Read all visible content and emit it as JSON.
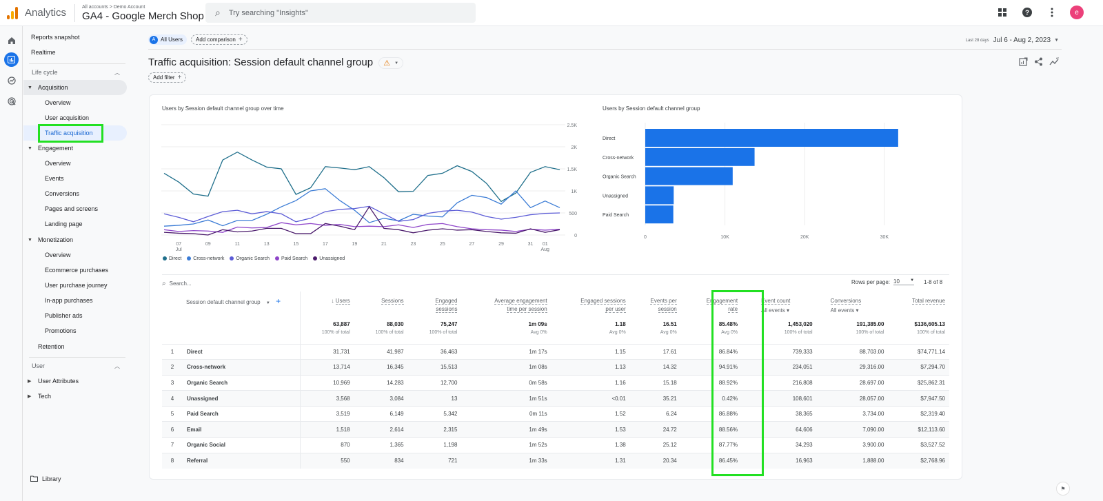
{
  "app": {
    "brand": "Analytics",
    "breadcrumb": "All accounts > Demo Account",
    "property": "GA4 - Google Merch Shop",
    "search_placeholder": "Try searching \"Insights\"",
    "avatar_initial": "e",
    "top_icons": [
      "apps-grid-icon",
      "help-icon",
      "more-vert-icon"
    ]
  },
  "rail": [
    "home-icon",
    "reports-icon",
    "explore-icon",
    "advertising-icon"
  ],
  "nav": {
    "top": [
      "Reports snapshot",
      "Realtime"
    ],
    "lifecycle_label": "Life cycle",
    "acquisition": {
      "label": "Acquisition",
      "items": [
        "Overview",
        "User acquisition",
        "Traffic acquisition"
      ]
    },
    "engagement": {
      "label": "Engagement",
      "items": [
        "Overview",
        "Events",
        "Conversions",
        "Pages and screens",
        "Landing page"
      ]
    },
    "monetization": {
      "label": "Monetization",
      "items": [
        "Overview",
        "Ecommerce purchases",
        "User purchase journey",
        "In-app purchases",
        "Publisher ads",
        "Promotions"
      ]
    },
    "retention": "Retention",
    "user_label": "User",
    "user_items": [
      "User Attributes",
      "Tech"
    ],
    "library": "Library"
  },
  "header": {
    "segment_badge": "A",
    "segment": "All Users",
    "add_comparison": "Add comparison",
    "date_prefix": "Last 28 days",
    "date_range": "Jul 6 - Aug 2, 2023",
    "title": "Traffic acquisition: Session default channel group",
    "add_filter": "Add filter"
  },
  "chart_data": [
    {
      "type": "line",
      "title": "Users by Session default channel group over time",
      "x": [
        "07 Jul",
        "08",
        "09",
        "10",
        "11",
        "12",
        "13",
        "14",
        "15",
        "16",
        "17",
        "18",
        "19",
        "20",
        "21",
        "22",
        "23",
        "24",
        "25",
        "26",
        "27",
        "28",
        "29",
        "30",
        "31",
        "01 Aug",
        "02"
      ],
      "x_full": [
        "Jul 6",
        "Jul 7",
        "Jul 8",
        "Jul 9",
        "Jul 10",
        "Jul 11",
        "Jul 12",
        "Jul 13",
        "Jul 14",
        "Jul 15",
        "Jul 16",
        "Jul 17",
        "Jul 18",
        "Jul 19",
        "Jul 20",
        "Jul 21",
        "Jul 22",
        "Jul 23",
        "Jul 24",
        "Jul 25",
        "Jul 26",
        "Jul 27",
        "Jul 28",
        "Jul 29",
        "Jul 30",
        "Jul 31",
        "Aug 1",
        "Aug 2"
      ],
      "x_tick_labels": [
        [
          "07",
          "Jul"
        ],
        [
          "09",
          ""
        ],
        [
          "11",
          ""
        ],
        [
          "13",
          ""
        ],
        [
          "15",
          ""
        ],
        [
          "17",
          ""
        ],
        [
          "19",
          ""
        ],
        [
          "21",
          ""
        ],
        [
          "23",
          ""
        ],
        [
          "25",
          ""
        ],
        [
          "27",
          ""
        ],
        [
          "29",
          ""
        ],
        [
          "31",
          ""
        ],
        [
          "01",
          "Aug"
        ]
      ],
      "x_tick_index": [
        1,
        3,
        5,
        7,
        9,
        11,
        13,
        15,
        17,
        19,
        21,
        23,
        25,
        26
      ],
      "y_ticks": [
        "0",
        "500",
        "1K",
        "1.5K",
        "2K",
        "2.5K"
      ],
      "ylim": [
        0,
        2500
      ],
      "grid": true,
      "legend_position": "bottom-left",
      "series": [
        {
          "name": "Direct",
          "color": "#1f6f8b",
          "values": [
            1400,
            1200,
            930,
            880,
            1700,
            1880,
            1700,
            1540,
            1500,
            920,
            1070,
            1550,
            1520,
            1480,
            1550,
            1300,
            980,
            990,
            1350,
            1400,
            1570,
            1440,
            1170,
            760,
            950,
            1420,
            1550,
            1480
          ]
        },
        {
          "name": "Cross-network",
          "color": "#3a7bd5",
          "values": [
            200,
            220,
            250,
            340,
            210,
            330,
            330,
            470,
            640,
            780,
            1000,
            1050,
            780,
            560,
            280,
            380,
            320,
            470,
            430,
            410,
            730,
            900,
            850,
            700,
            1000,
            620,
            770,
            620
          ]
        },
        {
          "name": "Organic Search",
          "color": "#5b5bd6",
          "values": [
            480,
            400,
            300,
            420,
            530,
            560,
            480,
            530,
            480,
            300,
            380,
            530,
            580,
            600,
            650,
            480,
            310,
            350,
            490,
            540,
            560,
            520,
            420,
            360,
            400,
            460,
            490,
            500
          ]
        },
        {
          "name": "Paid Search",
          "color": "#8e44c9",
          "values": [
            120,
            80,
            100,
            90,
            60,
            180,
            160,
            170,
            280,
            230,
            260,
            220,
            240,
            190,
            200,
            190,
            230,
            170,
            240,
            260,
            190,
            140,
            120,
            110,
            80,
            130,
            110,
            130
          ]
        },
        {
          "name": "Unassigned",
          "color": "#4a1a6b",
          "values": [
            60,
            40,
            30,
            -20,
            120,
            70,
            90,
            150,
            150,
            30,
            30,
            260,
            200,
            120,
            640,
            150,
            120,
            50,
            110,
            140,
            110,
            120,
            80,
            50,
            40,
            140,
            60,
            120
          ]
        }
      ]
    },
    {
      "type": "bar",
      "orientation": "horizontal",
      "title": "Users by Session default channel group",
      "categories": [
        "Direct",
        "Cross-network",
        "Organic Search",
        "Unassigned",
        "Paid Search"
      ],
      "values": [
        31731,
        13714,
        10969,
        3568,
        3519
      ],
      "x_ticks": [
        "0",
        "10K",
        "20K",
        "30K"
      ],
      "xlim": [
        0,
        32000
      ],
      "color": "#1a73e8",
      "grid": true
    }
  ],
  "table": {
    "search_placeholder": "Search...",
    "rows_per_page_label": "Rows per page:",
    "rows_per_page": "10",
    "pagination": "1-8 of 8",
    "dimension_header": "Session default channel group",
    "columns": [
      {
        "l1": "Users",
        "l2": "",
        "sorted": true
      },
      {
        "l1": "Sessions",
        "l2": ""
      },
      {
        "l1": "Engaged",
        "l2": "sessions"
      },
      {
        "l1": "Average engagement",
        "l2": "time per session"
      },
      {
        "l1": "Engaged sessions",
        "l2": "per user"
      },
      {
        "l1": "Events per",
        "l2": "session"
      },
      {
        "l1": "Engagement",
        "l2": "rate"
      },
      {
        "l1": "Event count",
        "l2": "",
        "select": "All events"
      },
      {
        "l1": "Conversions",
        "l2": "",
        "select": "All events"
      },
      {
        "l1": "Total revenue",
        "l2": ""
      }
    ],
    "totals": [
      {
        "v": "63,887",
        "s": "100% of total"
      },
      {
        "v": "88,030",
        "s": "100% of total"
      },
      {
        "v": "75,247",
        "s": "100% of total"
      },
      {
        "v": "1m 09s",
        "s": "Avg 0%"
      },
      {
        "v": "1.18",
        "s": "Avg 0%"
      },
      {
        "v": "16.51",
        "s": "Avg 0%"
      },
      {
        "v": "85.48%",
        "s": "Avg 0%"
      },
      {
        "v": "1,453,020",
        "s": "100% of total"
      },
      {
        "v": "191,385.00",
        "s": "100% of total"
      },
      {
        "v": "$136,605.13",
        "s": "100% of total"
      }
    ],
    "rows": [
      {
        "i": "1",
        "name": "Direct",
        "cells": [
          "31,731",
          "41,987",
          "36,463",
          "1m 17s",
          "1.15",
          "17.61",
          "86.84%",
          "739,333",
          "88,703.00",
          "$74,771.14"
        ]
      },
      {
        "i": "2",
        "name": "Cross-network",
        "cells": [
          "13,714",
          "16,345",
          "15,513",
          "1m 08s",
          "1.13",
          "14.32",
          "94.91%",
          "234,051",
          "29,316.00",
          "$7,294.70"
        ]
      },
      {
        "i": "3",
        "name": "Organic Search",
        "cells": [
          "10,969",
          "14,283",
          "12,700",
          "0m 58s",
          "1.16",
          "15.18",
          "88.92%",
          "216,808",
          "28,697.00",
          "$25,862.31"
        ]
      },
      {
        "i": "4",
        "name": "Unassigned",
        "cells": [
          "3,568",
          "3,084",
          "13",
          "1m 51s",
          "<0.01",
          "35.21",
          "0.42%",
          "108,601",
          "28,057.00",
          "$7,947.50"
        ]
      },
      {
        "i": "5",
        "name": "Paid Search",
        "cells": [
          "3,519",
          "6,149",
          "5,342",
          "0m 11s",
          "1.52",
          "6.24",
          "86.88%",
          "38,365",
          "3,734.00",
          "$2,319.40"
        ]
      },
      {
        "i": "6",
        "name": "Email",
        "cells": [
          "1,518",
          "2,614",
          "2,315",
          "1m 49s",
          "1.53",
          "24.72",
          "88.56%",
          "64,606",
          "7,090.00",
          "$12,113.60"
        ]
      },
      {
        "i": "7",
        "name": "Organic Social",
        "cells": [
          "870",
          "1,365",
          "1,198",
          "1m 52s",
          "1.38",
          "25.12",
          "87.77%",
          "34,293",
          "3,900.00",
          "$3,527.52"
        ]
      },
      {
        "i": "8",
        "name": "Referral",
        "cells": [
          "550",
          "834",
          "721",
          "1m 33s",
          "1.31",
          "20.34",
          "86.45%",
          "16,963",
          "1,888.00",
          "$2,768.96"
        ]
      }
    ]
  },
  "highlight_color": "#22e022"
}
